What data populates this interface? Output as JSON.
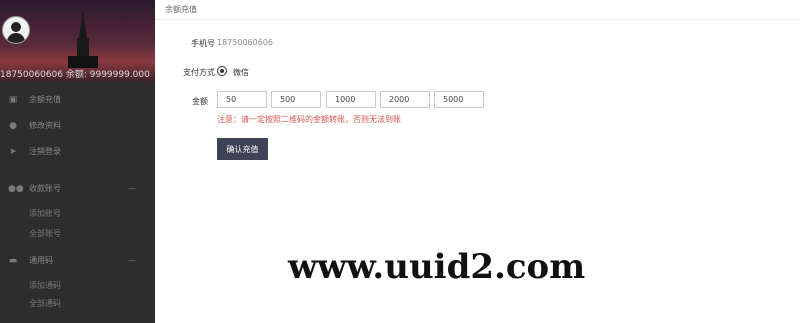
{
  "sidebar": {
    "profile_line": "18750060606 余额: 9999999.000",
    "menu": [
      {
        "icon": "lock-icon",
        "label": "余额充值"
      },
      {
        "icon": "user-icon",
        "label": "修改资料"
      },
      {
        "icon": "logout-icon",
        "label": "注销登录"
      },
      {
        "icon": "users-icon",
        "label": "收款账号",
        "arrow": "—"
      },
      {
        "icon": "card-icon",
        "label": "通用码",
        "arrow": "—"
      }
    ],
    "sub_items": [
      "添加账号",
      "全部账号",
      "添加通码",
      "全部通码"
    ]
  },
  "main": {
    "title": "余额充值",
    "phone_label": "手机号",
    "phone_value": "18750060606",
    "pay_method_label": "支付方式",
    "pay_method_value": "微信",
    "amount_label": "金额",
    "amounts": [
      "50",
      "500",
      "1000",
      "2000",
      "5000"
    ],
    "notice": "注意：请一定按照二维码的金额转账，否则无法到账",
    "confirm_label": "确认充值"
  },
  "watermark": "www.uuid2.com"
}
